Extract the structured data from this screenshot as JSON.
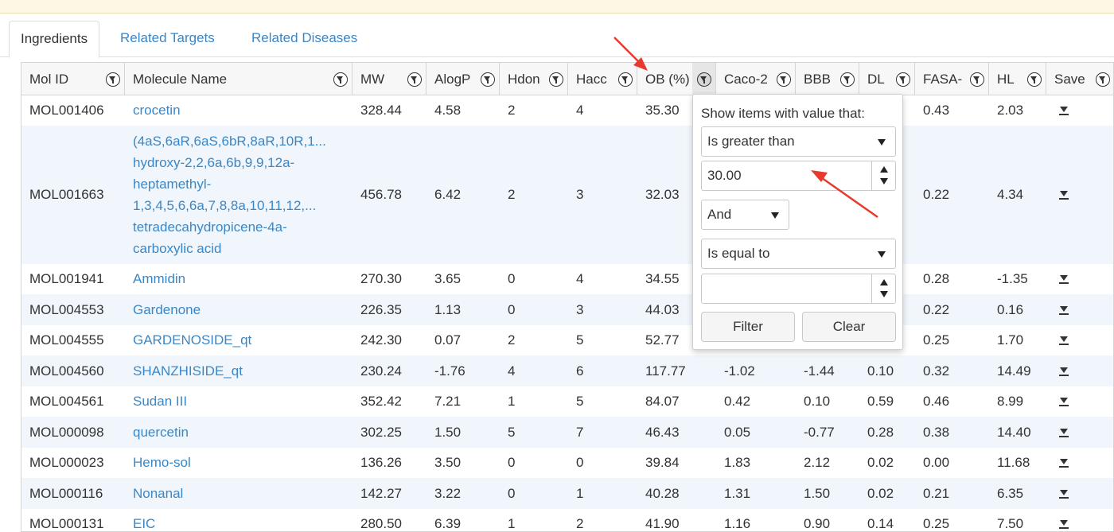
{
  "tabs": [
    "Ingredients",
    "Related Targets",
    "Related Diseases"
  ],
  "columns": [
    "Mol ID",
    "Molecule Name",
    "MW",
    "AlogP",
    "Hdon",
    "Hacc",
    "OB (%)",
    "Caco-2",
    "BBB",
    "DL",
    "FASA-",
    "HL",
    "Save"
  ],
  "rows": [
    {
      "mol_id": "MOL001406",
      "name": [
        "crocetin"
      ],
      "mw": "328.44",
      "alogp": "4.58",
      "hdon": "2",
      "hacc": "4",
      "ob": "35.30",
      "caco2": "",
      "bbb": "",
      "dl": "",
      "fasa": "0.43",
      "hl": "2.03"
    },
    {
      "mol_id": "MOL001663",
      "name": [
        "(4aS,6aR,6aS,6bR,8aR,10R,1...",
        "hydroxy-2,2,6a,6b,9,9,12a-",
        "heptamethyl-",
        "1,3,4,5,6,6a,7,8,8a,10,11,12,...",
        "tetradecahydropicene-4a-",
        "carboxylic acid"
      ],
      "mw": "456.78",
      "alogp": "6.42",
      "hdon": "2",
      "hacc": "3",
      "ob": "32.03",
      "caco2": "",
      "bbb": "",
      "dl": "",
      "fasa": "0.22",
      "hl": "4.34"
    },
    {
      "mol_id": "MOL001941",
      "name": [
        "Ammidin"
      ],
      "mw": "270.30",
      "alogp": "3.65",
      "hdon": "0",
      "hacc": "4",
      "ob": "34.55",
      "caco2": "",
      "bbb": "",
      "dl": "",
      "fasa": "0.28",
      "hl": "-1.35"
    },
    {
      "mol_id": "MOL004553",
      "name": [
        "Gardenone"
      ],
      "mw": "226.35",
      "alogp": "1.13",
      "hdon": "0",
      "hacc": "3",
      "ob": "44.03",
      "caco2": "",
      "bbb": "",
      "dl": "",
      "fasa": "0.22",
      "hl": "0.16"
    },
    {
      "mol_id": "MOL004555",
      "name": [
        "GARDENOSIDE_qt"
      ],
      "mw": "242.30",
      "alogp": "0.07",
      "hdon": "2",
      "hacc": "5",
      "ob": "52.77",
      "caco2": "",
      "bbb": "",
      "dl": "",
      "fasa": "0.25",
      "hl": "1.70"
    },
    {
      "mol_id": "MOL004560",
      "name": [
        "SHANZHISIDE_qt"
      ],
      "mw": "230.24",
      "alogp": "-1.76",
      "hdon": "4",
      "hacc": "6",
      "ob": "117.77",
      "caco2": "-1.02",
      "bbb": "-1.44",
      "dl": "0.10",
      "fasa": "0.32",
      "hl": "14.49"
    },
    {
      "mol_id": "MOL004561",
      "name": [
        "Sudan III"
      ],
      "mw": "352.42",
      "alogp": "7.21",
      "hdon": "1",
      "hacc": "5",
      "ob": "84.07",
      "caco2": "0.42",
      "bbb": "0.10",
      "dl": "0.59",
      "fasa": "0.46",
      "hl": "8.99"
    },
    {
      "mol_id": "MOL000098",
      "name": [
        "quercetin"
      ],
      "mw": "302.25",
      "alogp": "1.50",
      "hdon": "5",
      "hacc": "7",
      "ob": "46.43",
      "caco2": "0.05",
      "bbb": "-0.77",
      "dl": "0.28",
      "fasa": "0.38",
      "hl": "14.40"
    },
    {
      "mol_id": "MOL000023",
      "name": [
        "Hemo-sol"
      ],
      "mw": "136.26",
      "alogp": "3.50",
      "hdon": "0",
      "hacc": "0",
      "ob": "39.84",
      "caco2": "1.83",
      "bbb": "2.12",
      "dl": "0.02",
      "fasa": "0.00",
      "hl": "11.68"
    },
    {
      "mol_id": "MOL000116",
      "name": [
        "Nonanal"
      ],
      "mw": "142.27",
      "alogp": "3.22",
      "hdon": "0",
      "hacc": "1",
      "ob": "40.28",
      "caco2": "1.31",
      "bbb": "1.50",
      "dl": "0.02",
      "fasa": "0.21",
      "hl": "6.35"
    },
    {
      "mol_id": "MOL000131",
      "name": [
        "EIC"
      ],
      "mw": "280.50",
      "alogp": "6.39",
      "hdon": "1",
      "hacc": "2",
      "ob": "41.90",
      "caco2": "1.16",
      "bbb": "0.90",
      "dl": "0.14",
      "fasa": "0.25",
      "hl": "7.50"
    }
  ],
  "filter_popup": {
    "title": "Show items with value that:",
    "operator1": "Is greater than",
    "value1": "30.00",
    "logic": "And",
    "operator2": "Is equal to",
    "value2": "",
    "filter_label": "Filter",
    "clear_label": "Clear"
  },
  "colors": {
    "link": "#3a87c7",
    "arrow": "#e8392f",
    "alt_row": "#f0f6fb"
  }
}
